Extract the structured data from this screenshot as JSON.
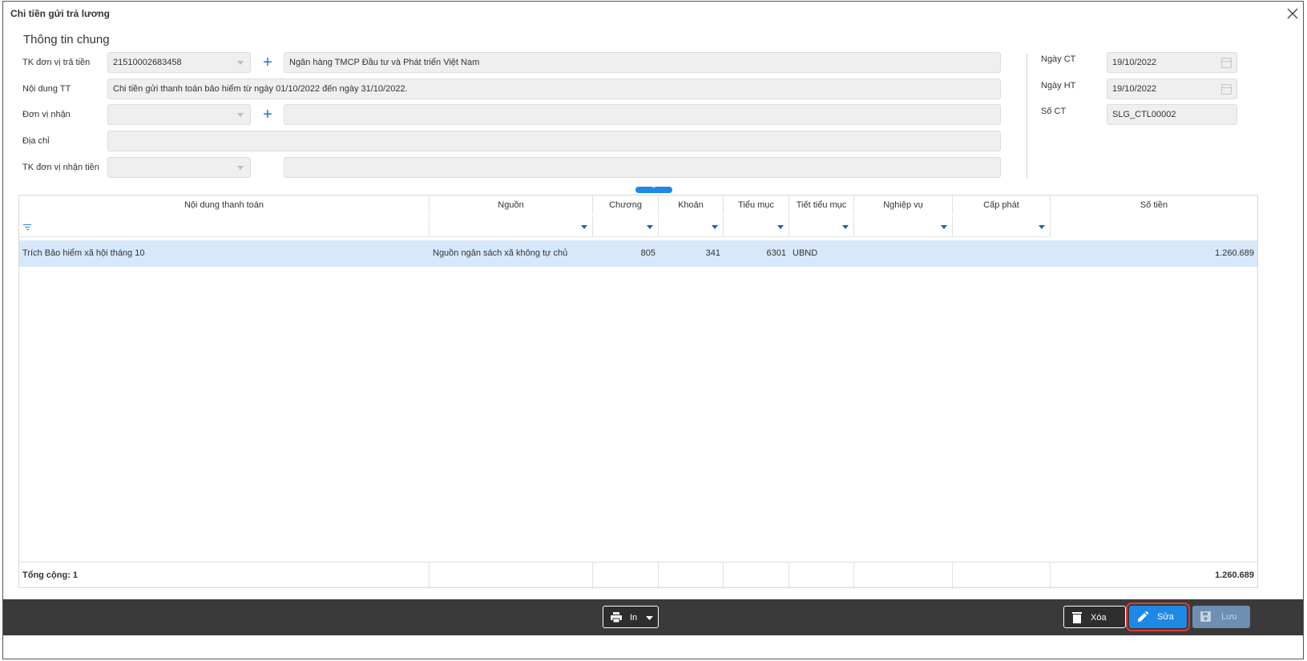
{
  "dialog": {
    "title": "Chi tiền gửi trả lương",
    "section_title": "Thông tin chung"
  },
  "form": {
    "tk_don_vi_tra_tien": {
      "label": "TK đơn vị trả tiền",
      "value": "21510002683458",
      "bank_name": "Ngân hàng TMCP Đầu tư và Phát triển Việt Nam"
    },
    "noi_dung_tt": {
      "label": "Nội dung TT",
      "value": "Chi tiền gửi thanh toán bảo hiểm từ ngày 01/10/2022 đến ngày 31/10/2022."
    },
    "don_vi_nhan": {
      "label": "Đơn vị nhận",
      "value": "",
      "name": ""
    },
    "dia_chi": {
      "label": "Địa chỉ",
      "value": ""
    },
    "tk_don_vi_nhan_tien": {
      "label": "TK đơn vị nhận tiền",
      "value": "",
      "bank_name": ""
    },
    "ngay_ct": {
      "label": "Ngày CT",
      "value": "19/10/2022"
    },
    "ngay_ht": {
      "label": "Ngày HT",
      "value": "19/10/2022"
    },
    "so_ct": {
      "label": "Số CT",
      "value": "SLG_CTL00002"
    }
  },
  "grid": {
    "columns": [
      "Nội dung thanh toán",
      "Nguồn",
      "Chương",
      "Khoản",
      "Tiểu mục",
      "Tiết tiểu mục",
      "Nghiệp vụ",
      "Cấp phát",
      "Số tiền"
    ],
    "rows": [
      {
        "noi_dung": "Trích Bảo hiểm xã hội tháng 10",
        "nguon": "Nguồn ngân sách xã không tự chủ",
        "chuong": "805",
        "khoan": "341",
        "tieu_muc": "6301",
        "tiet_tieu_muc": "UBND",
        "nghiep_vu": "",
        "cap_phat": "",
        "so_tien": "1.260.689"
      }
    ],
    "footer": {
      "label": "Tổng cộng: 1",
      "total": "1.260.689"
    }
  },
  "actions": {
    "print": "In",
    "delete": "Xóa",
    "edit": "Sửa",
    "save": "Lưu"
  },
  "colors": {
    "accent": "#1e88e5",
    "selected_row": "#d7e8fb",
    "bottom_bar": "#3a3a3a",
    "highlight_outline": "#e53935"
  }
}
